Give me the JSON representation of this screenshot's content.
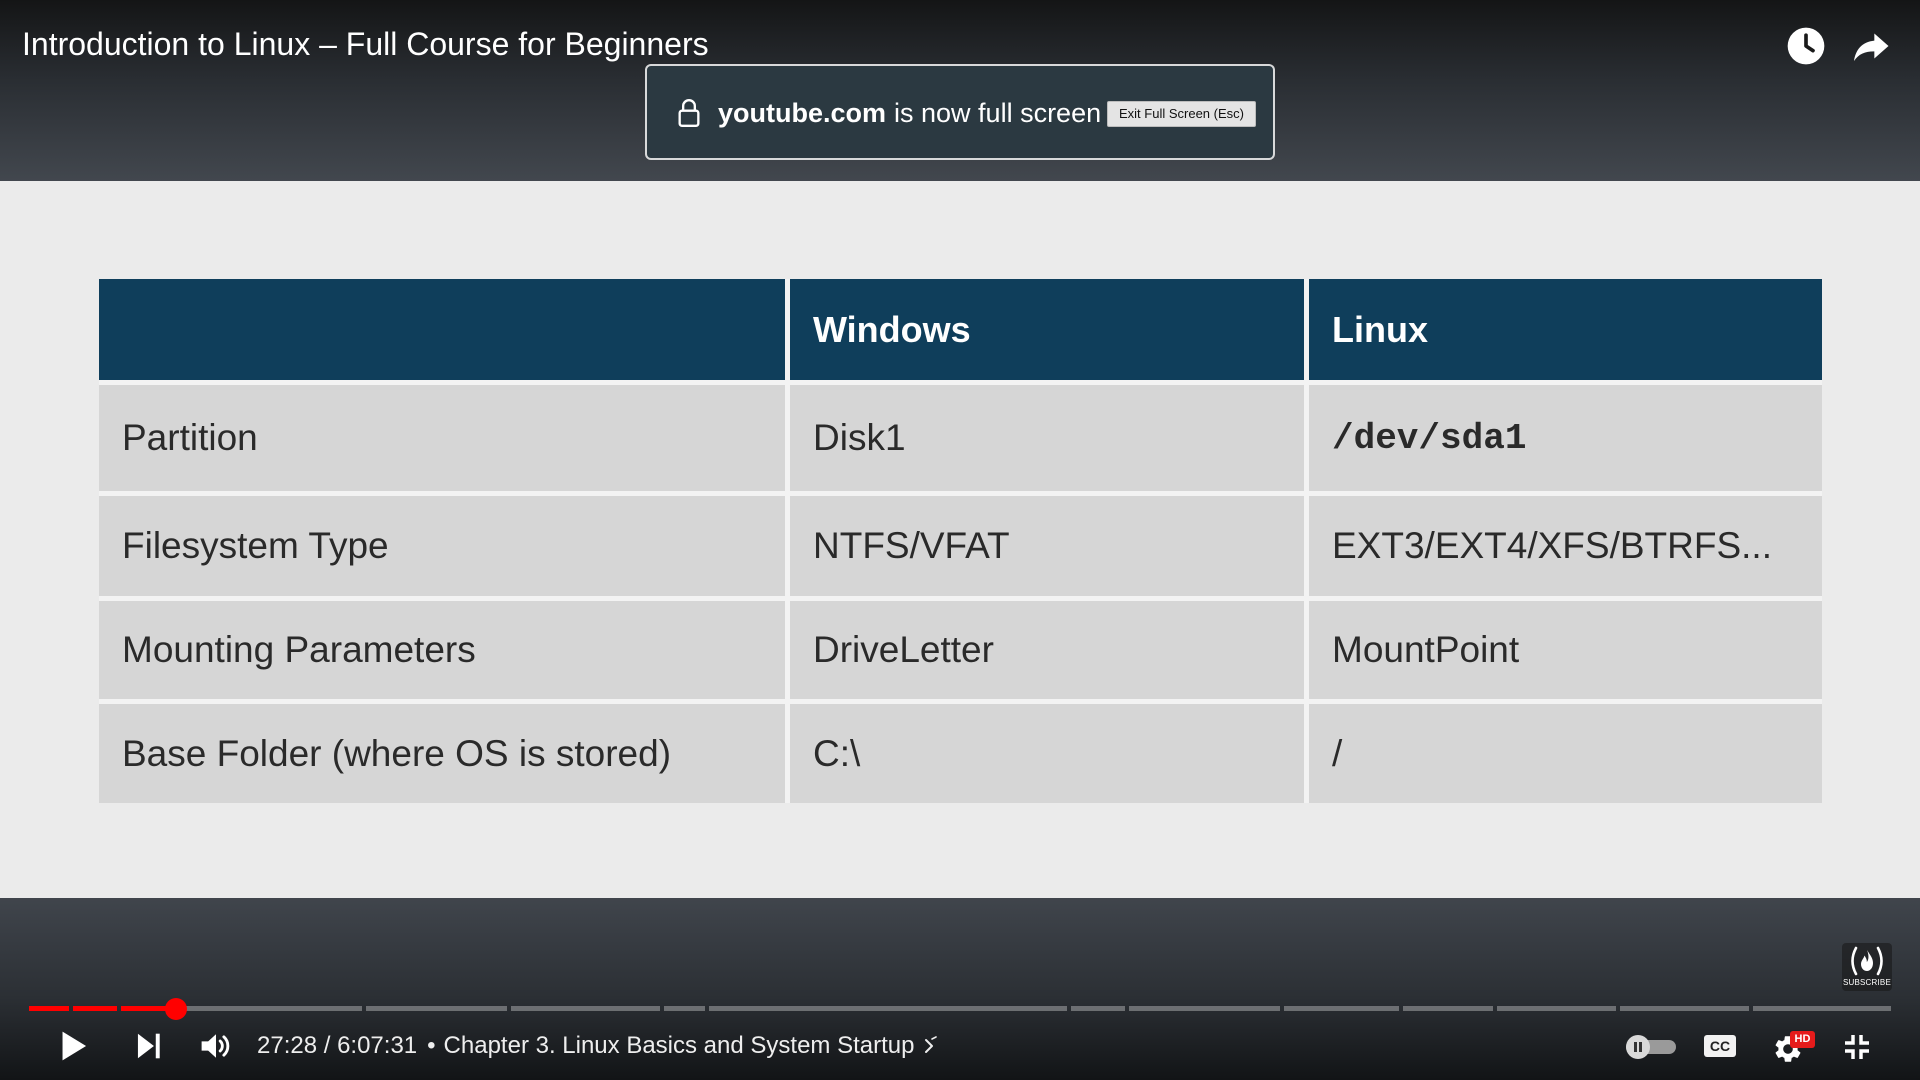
{
  "video": {
    "title": "Introduction to Linux – Full Course for Beginners"
  },
  "top_actions": {
    "watch_later_icon": "clock-icon",
    "share_icon": "share-icon"
  },
  "fullscreen_notice": {
    "icon": "lock-icon",
    "domain": "youtube.com",
    "message": "is now full screen",
    "exit_button": "Exit Full Screen (Esc)"
  },
  "slide": {
    "table": {
      "headers": [
        "",
        "Windows",
        "Linux"
      ],
      "rows": [
        [
          "Partition",
          "Disk1",
          "/dev/sda1"
        ],
        [
          "Filesystem Type",
          "NTFS/VFAT",
          "EXT3/EXT4/XFS/BTRFS..."
        ],
        [
          "Mounting Parameters",
          "DriveLetter",
          "MountPoint"
        ],
        [
          "Base Folder (where OS is stored)",
          "C:\\",
          "/"
        ]
      ]
    }
  },
  "watermark": {
    "icon": "freecodecamp-logo-icon",
    "label": "SUBSCRIBE"
  },
  "player": {
    "time_display": "27:28 / 6:07:31",
    "chapter_bullet": "•",
    "chapter": "Chapter 3. Linux Basics and System Startup",
    "progress_fraction": 0.079,
    "cc_label": "CC",
    "hd_label": "HD",
    "icons": [
      "play-icon",
      "next-icon",
      "volume-icon",
      "chevron-right-icon",
      "autoplay-toggle-icon",
      "settings-icon",
      "exit-fullscreen-icon"
    ]
  },
  "colors": {
    "accent_red": "#ff0000",
    "table_header": "#0f3e5b",
    "table_cell": "#d6d6d6",
    "slide_background": "#ebebeb",
    "hd_badge": "#e51b1b"
  }
}
